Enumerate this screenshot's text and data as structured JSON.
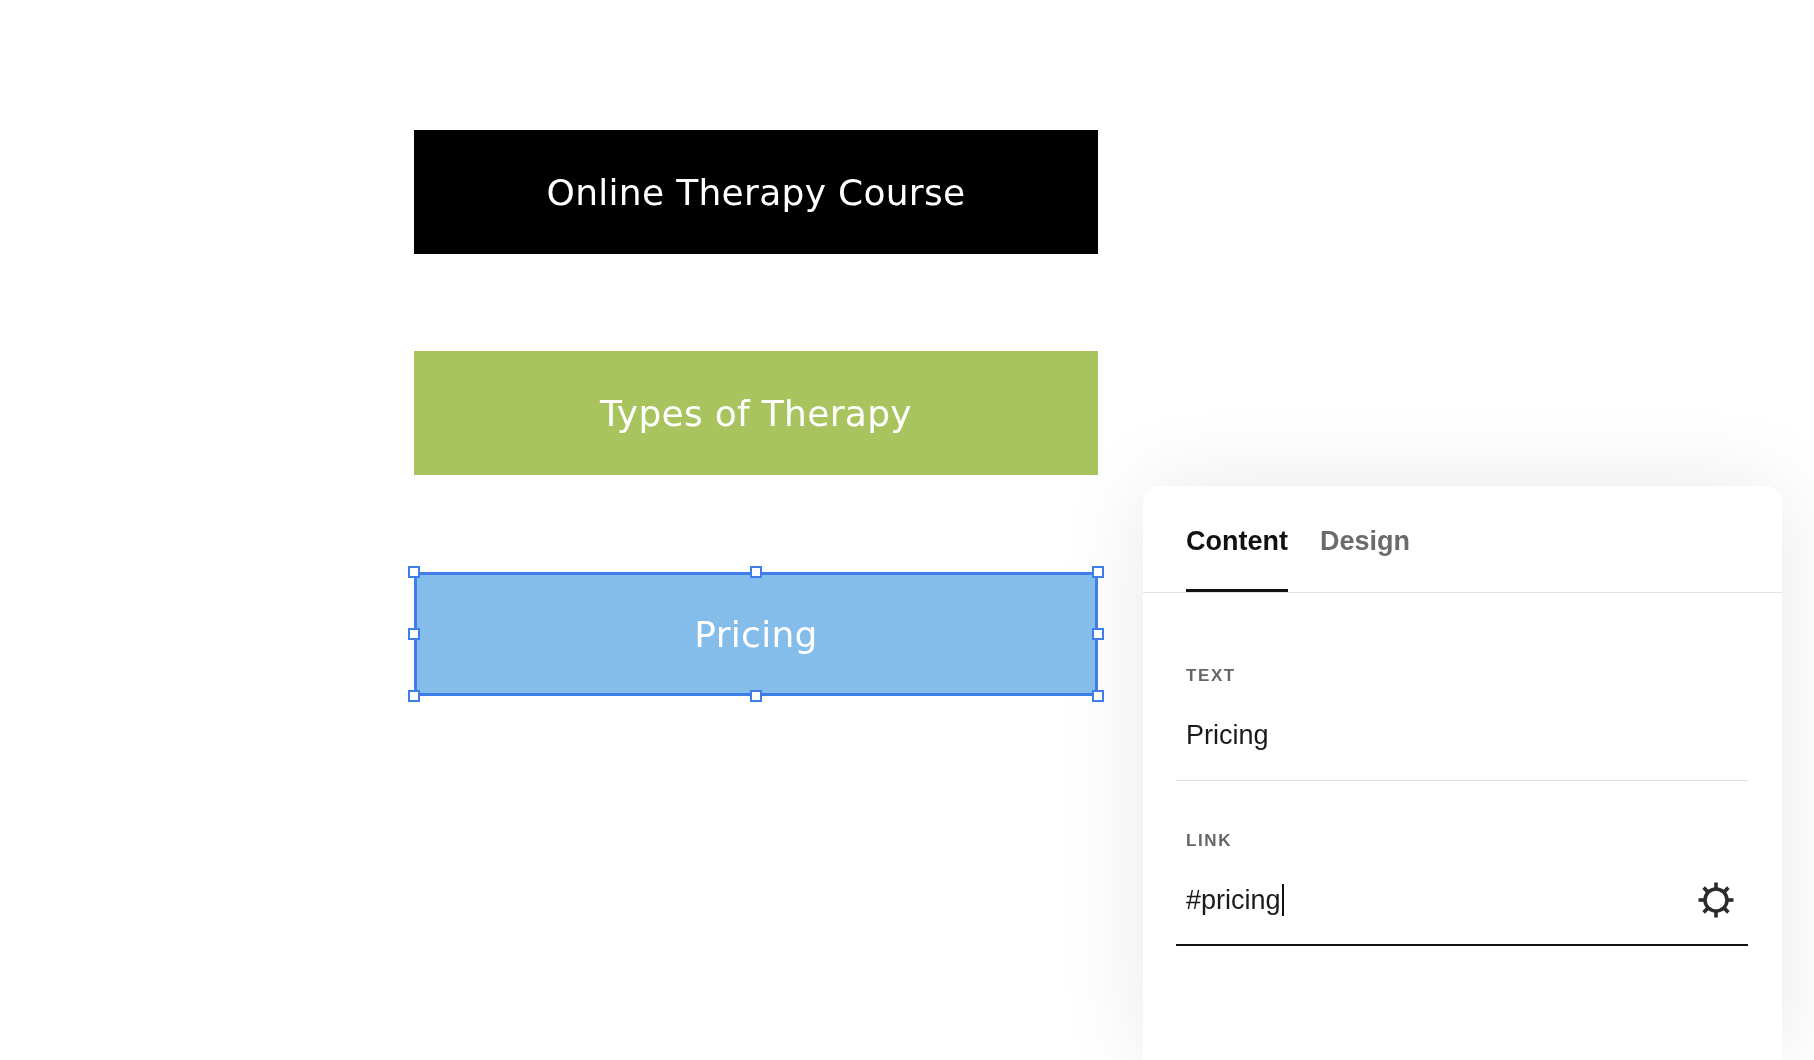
{
  "canvas": {
    "buttons": [
      {
        "label": "Online Therapy Course",
        "color": "#000000",
        "selected": false
      },
      {
        "label": "Types of Therapy",
        "color": "#a9c45e",
        "selected": false
      },
      {
        "label": "Pricing",
        "color": "#84bcea",
        "selected": true
      }
    ]
  },
  "editor": {
    "tabs": [
      {
        "label": "Content",
        "selected": true
      },
      {
        "label": "Design",
        "selected": false
      }
    ],
    "fields": [
      {
        "kind": "text",
        "label": "TEXT",
        "value": "Pricing",
        "focused": false
      },
      {
        "kind": "link",
        "label": "LINK",
        "value": "#pricing",
        "focused": true
      }
    ]
  }
}
